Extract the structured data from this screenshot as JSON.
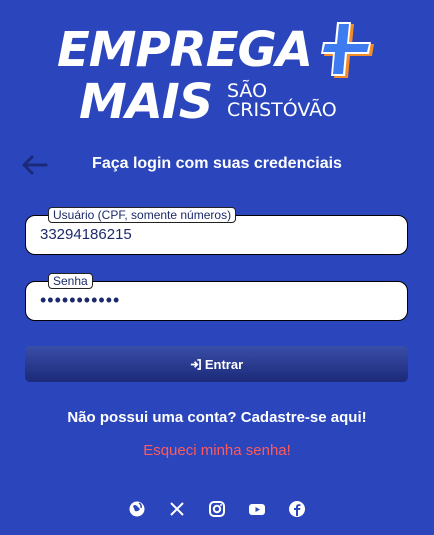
{
  "logo": {
    "line1": "EMPREGA",
    "line2": "MAIS",
    "sub1": "SÃO",
    "sub2": "CRISTÓVÃO"
  },
  "header": {
    "back_icon": "arrow-left-icon",
    "title": "Faça login com suas credenciais"
  },
  "form": {
    "user_label": "Usuário (CPF, somente números)",
    "user_value": "33294186215",
    "pass_label": "Senha",
    "pass_value": "•••••••••••",
    "login_icon": "sign-in-icon",
    "login_label": "Entrar"
  },
  "links": {
    "signup_text": "Não possui uma conta? Cadastre-se aqui!",
    "forgot_text": "Esqueci minha senha!"
  },
  "social": [
    "globe-icon",
    "x-icon",
    "instagram-icon",
    "youtube-icon",
    "facebook-icon"
  ],
  "colors": {
    "background": "#2b46bd",
    "button": "#1b2a78",
    "forgot": "#ff5a5a",
    "plus_blue": "#3d7bf0",
    "plus_orange": "#f28c28"
  }
}
